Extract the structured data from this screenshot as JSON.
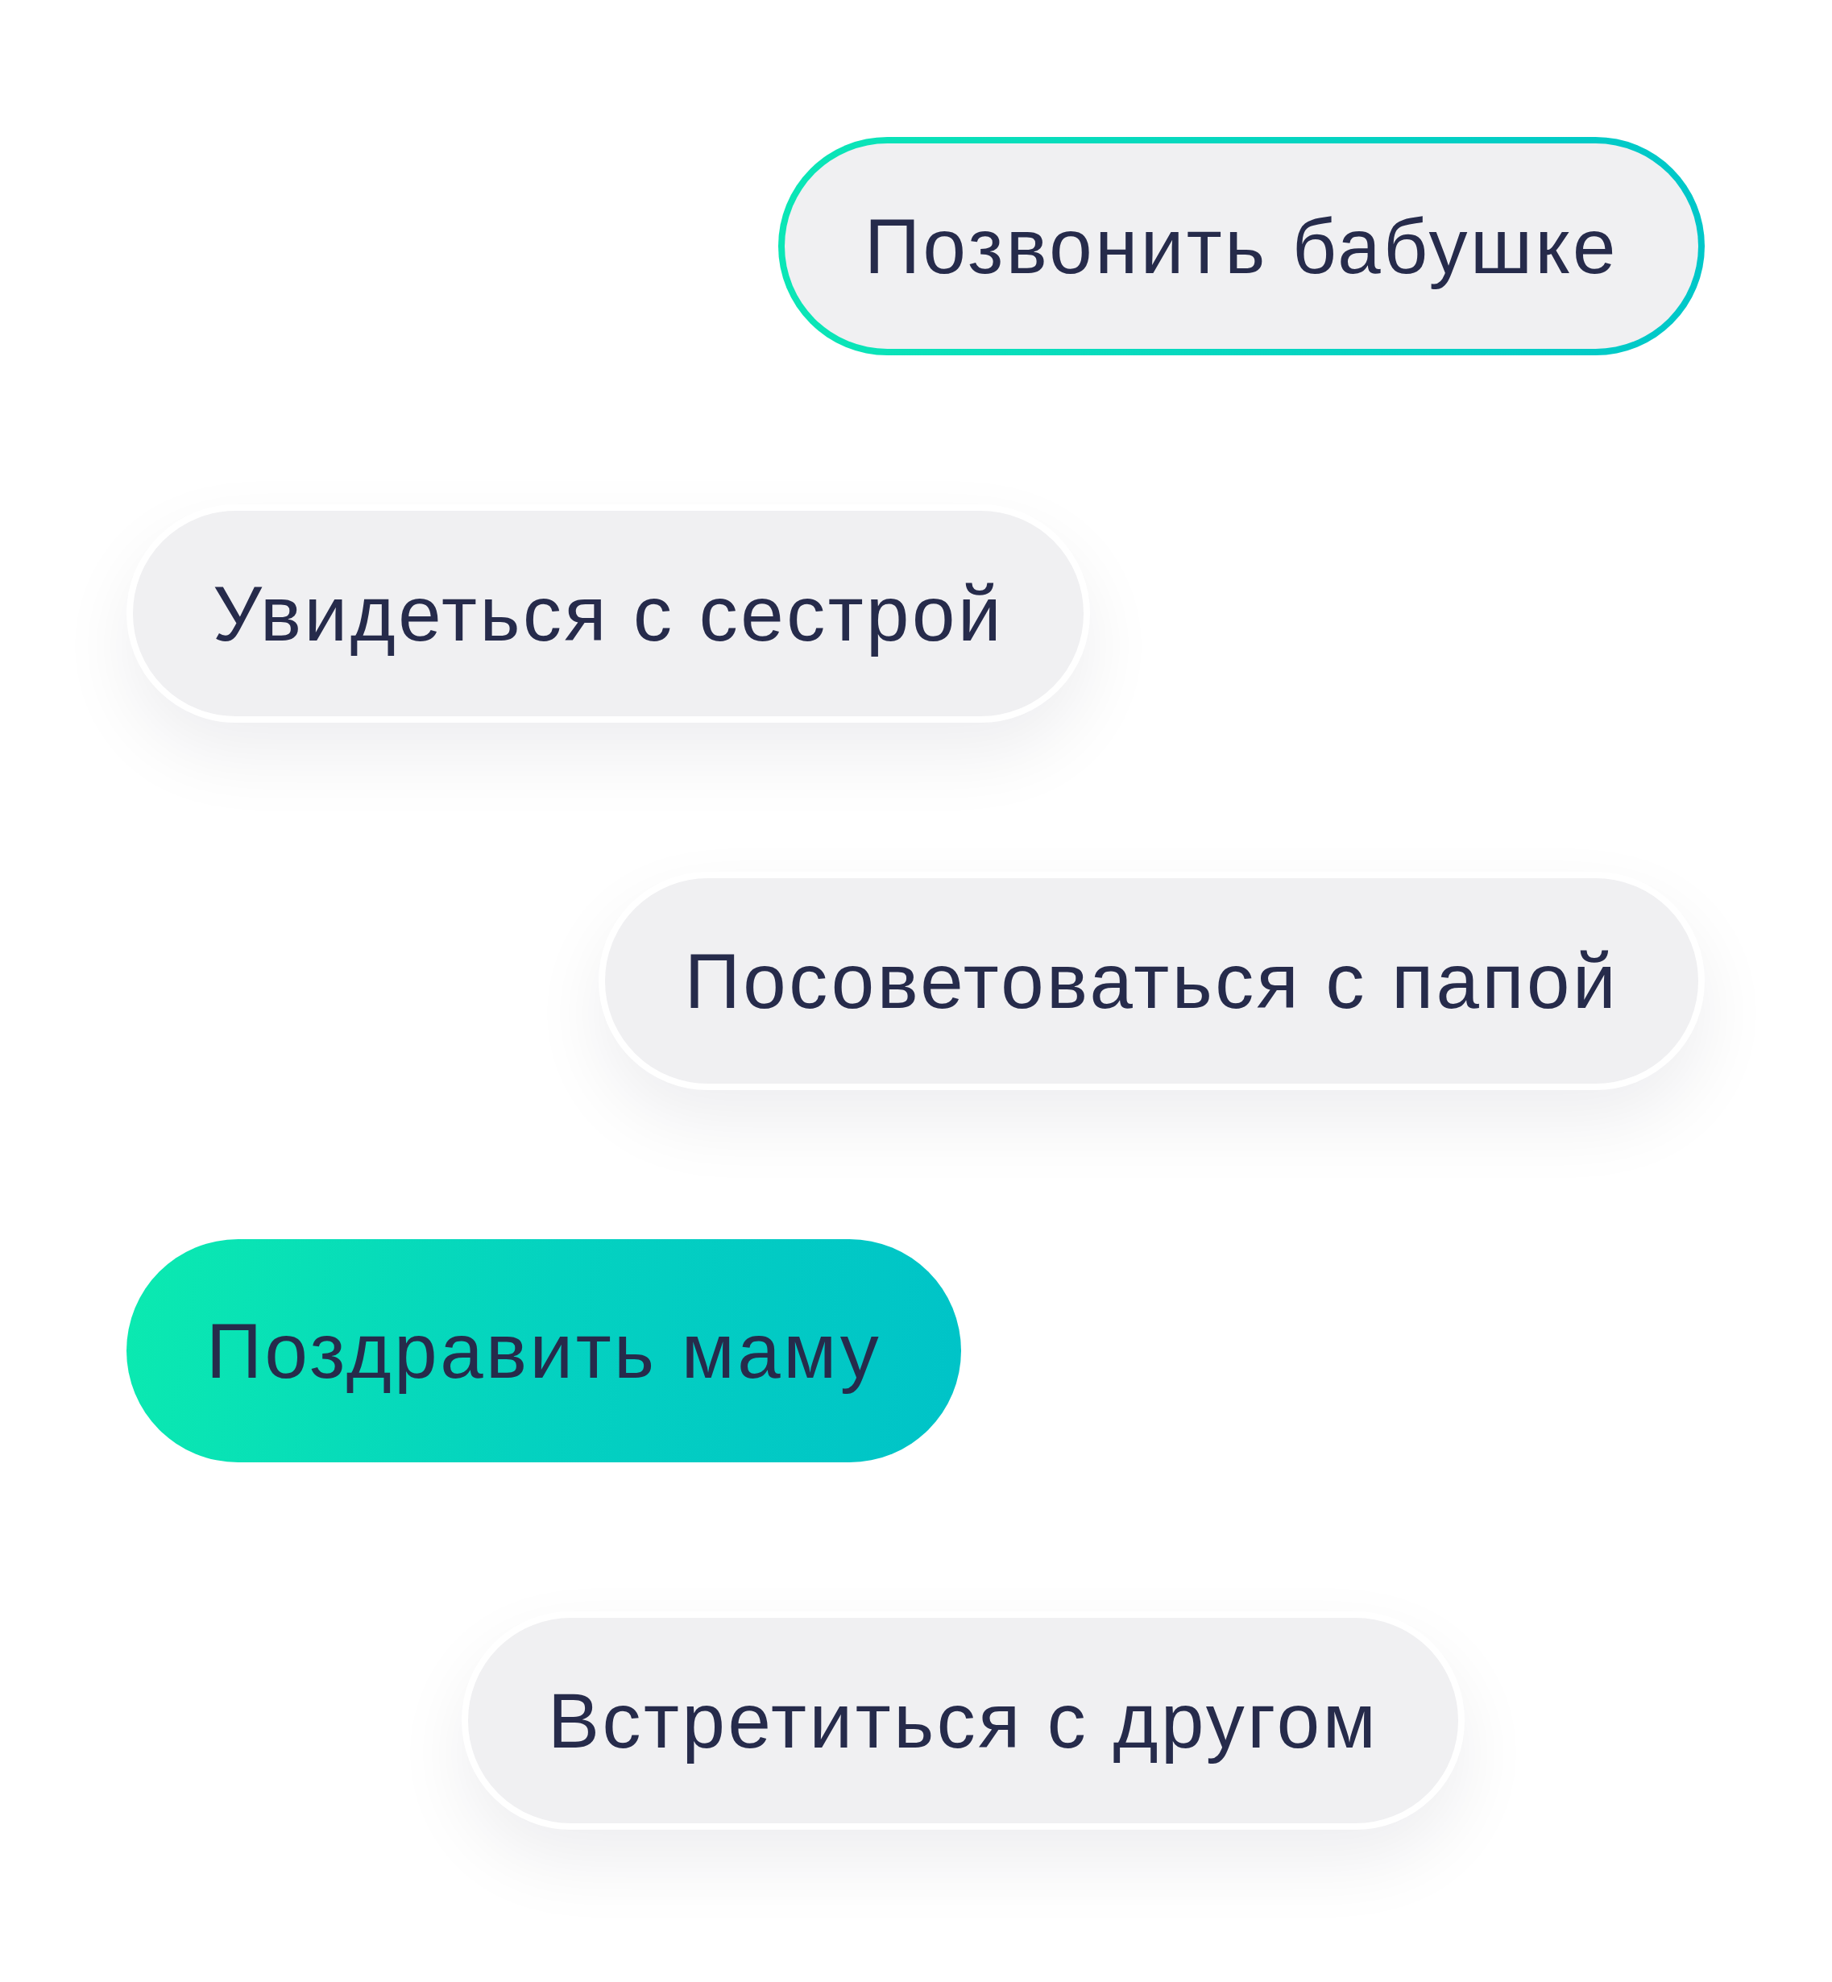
{
  "chips": [
    {
      "label": "Позвонить бабушке",
      "kind": "outlined"
    },
    {
      "label": "Увидеться с сестрой",
      "kind": "raised"
    },
    {
      "label": "Посоветоваться с папой",
      "kind": "raised"
    },
    {
      "label": "Поздравить маму",
      "kind": "filled"
    },
    {
      "label": "Встретиться с другом",
      "kind": "raised"
    }
  ]
}
